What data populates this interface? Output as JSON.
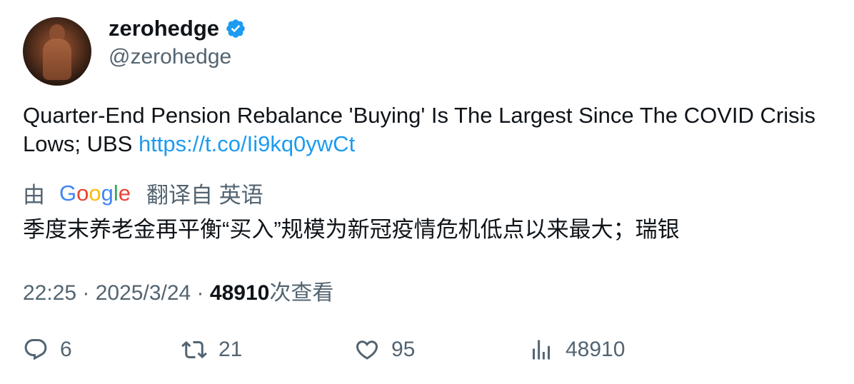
{
  "author": {
    "display_name": "zerohedge",
    "handle": "@zerohedge",
    "avatar_icon": "avatar-photo",
    "verified_icon": "verified-badge-icon",
    "verified_color": "#1d9bf0"
  },
  "tweet": {
    "text": "Quarter-End Pension Rebalance 'Buying' Is The Largest Since The COVID Crisis Lows; UBS ",
    "link": "https://t.co/Ii9kq0ywCt",
    "link_color": "#1d9bf0"
  },
  "translation": {
    "prefix": "由",
    "google_letters": [
      "G",
      "o",
      "o",
      "g",
      "l",
      "e"
    ],
    "suffix": "翻译自 英语",
    "text": "季度末养老金再平衡“买入”规模为新冠疫情危机低点以来最大；瑞银"
  },
  "meta": {
    "time": "22:25",
    "sep1": " · ",
    "date": "2025/3/24",
    "sep2": " · ",
    "views": "48910",
    "views_label": "次查看"
  },
  "actions": {
    "replies": "6",
    "retweets": "21",
    "likes": "95",
    "views": "48910",
    "icons": [
      "reply-icon",
      "retweet-icon",
      "like-icon",
      "views-icon"
    ],
    "icon_color": "#536471"
  }
}
